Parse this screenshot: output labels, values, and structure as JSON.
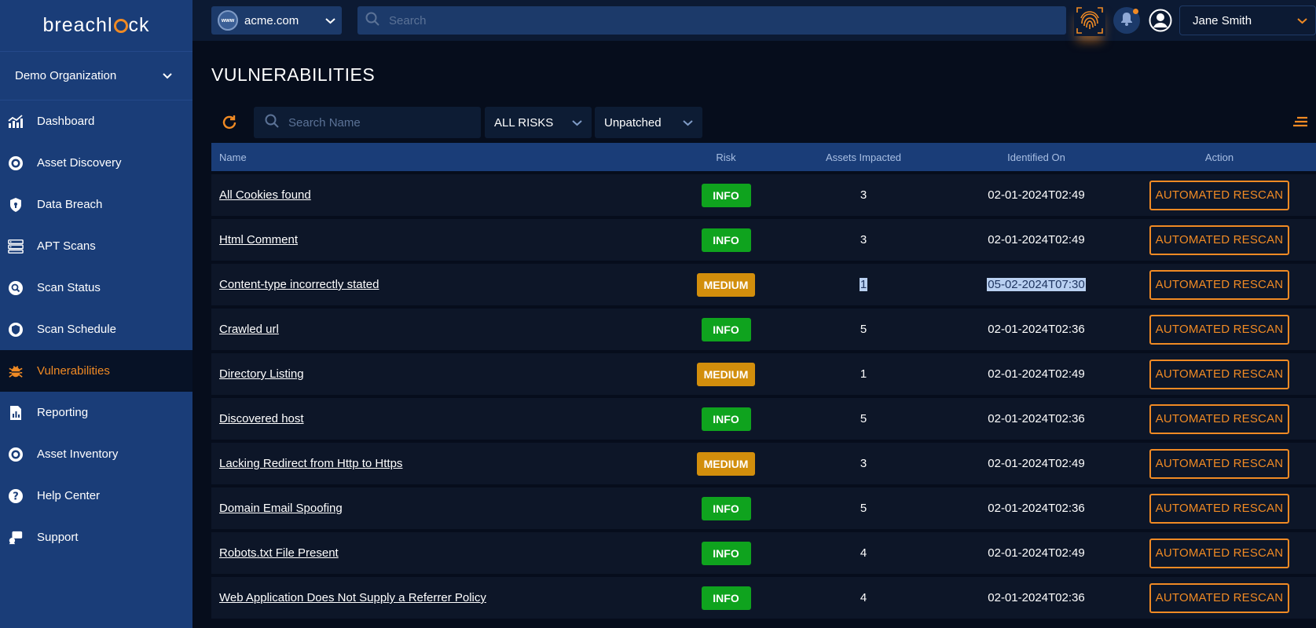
{
  "brand": {
    "logo_text_left": "breachl",
    "logo_text_right": "ck"
  },
  "sidebar": {
    "org": "Demo Organization",
    "items": [
      {
        "label": "Dashboard",
        "icon": "chart-line-icon"
      },
      {
        "label": "Asset Discovery",
        "icon": "target-icon"
      },
      {
        "label": "Data Breach",
        "icon": "shield-icon"
      },
      {
        "label": "APT Scans",
        "icon": "server-icon"
      },
      {
        "label": "Scan Status",
        "icon": "search-bubble-icon"
      },
      {
        "label": "Scan Schedule",
        "icon": "shield-check-icon"
      },
      {
        "label": "Vulnerabilities",
        "icon": "bug-icon",
        "active": true
      },
      {
        "label": "Reporting",
        "icon": "report-icon"
      },
      {
        "label": "Asset Inventory",
        "icon": "target-icon"
      },
      {
        "label": "Help Center",
        "icon": "help-icon"
      },
      {
        "label": "Support",
        "icon": "support-icon"
      }
    ]
  },
  "topbar": {
    "domain_badge": "www",
    "domain": "acme.com",
    "search_placeholder": "Search",
    "user_name": "Jane Smith"
  },
  "page": {
    "title": "VULNERABILITIES",
    "search_placeholder": "Search Name",
    "risk_filter": "ALL RISKS",
    "status_filter": "Unpatched"
  },
  "table": {
    "headers": {
      "name": "Name",
      "risk": "Risk",
      "assets": "Assets Impacted",
      "date": "Identified On",
      "action": "Action"
    },
    "action_label": "AUTOMATED RESCAN",
    "rows": [
      {
        "name": "All Cookies found",
        "risk": "INFO",
        "assets": "3",
        "date": "02-01-2024T02:49"
      },
      {
        "name": "Html Comment",
        "risk": "INFO",
        "assets": "3",
        "date": "02-01-2024T02:49"
      },
      {
        "name": "Content-type incorrectly stated",
        "risk": "MEDIUM",
        "assets": "1",
        "date": "05-02-2024T07:30",
        "selected": true
      },
      {
        "name": "Crawled url",
        "risk": "INFO",
        "assets": "5",
        "date": "02-01-2024T02:36"
      },
      {
        "name": "Directory Listing",
        "risk": "MEDIUM",
        "assets": "1",
        "date": "02-01-2024T02:49"
      },
      {
        "name": "Discovered host",
        "risk": "INFO",
        "assets": "5",
        "date": "02-01-2024T02:36"
      },
      {
        "name": "Lacking Redirect from Http to Https",
        "risk": "MEDIUM",
        "assets": "3",
        "date": "02-01-2024T02:49"
      },
      {
        "name": "Domain Email Spoofing",
        "risk": "INFO",
        "assets": "5",
        "date": "02-01-2024T02:36"
      },
      {
        "name": "Robots.txt File Present",
        "risk": "INFO",
        "assets": "4",
        "date": "02-01-2024T02:49"
      },
      {
        "name": "Web Application Does Not Supply a Referrer Policy",
        "risk": "INFO",
        "assets": "4",
        "date": "02-01-2024T02:36"
      }
    ]
  },
  "colors": {
    "sidebar": "#1a3d78",
    "accent": "#f08a24",
    "info": "#0fa31e",
    "medium": "#d28e0c",
    "background": "#060d1c"
  }
}
